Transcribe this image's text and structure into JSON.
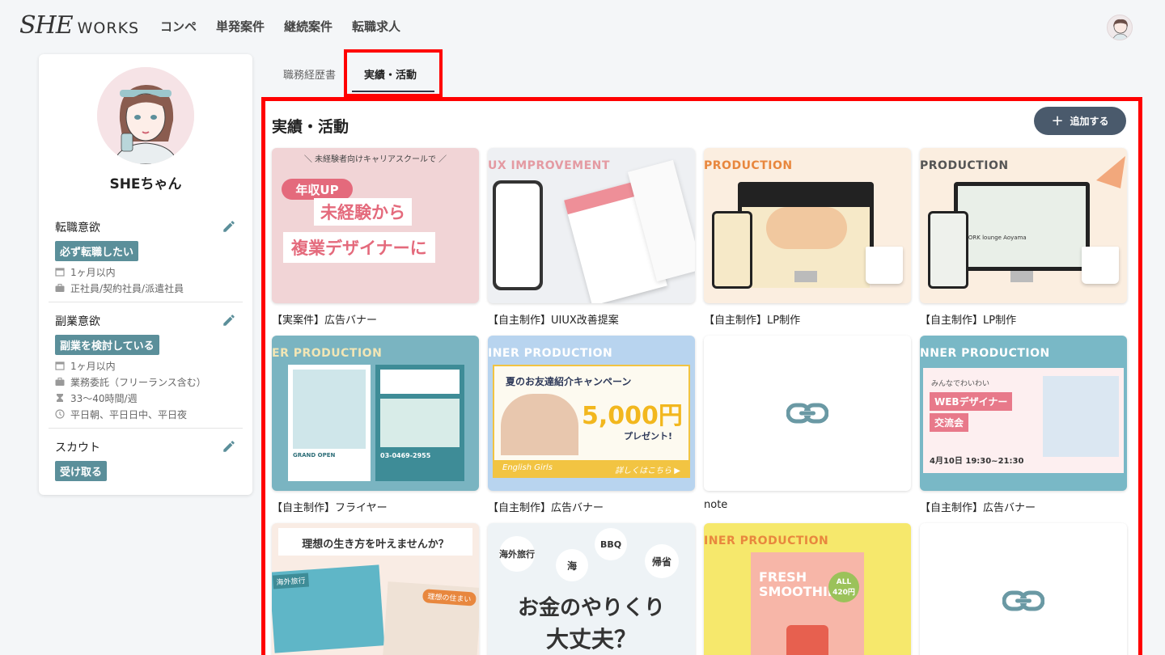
{
  "header": {
    "logo_she": "SHE",
    "logo_works": "WORKS",
    "nav": [
      "コンペ",
      "単発案件",
      "継続案件",
      "転職求人"
    ]
  },
  "profile": {
    "name": "SHEちゃん",
    "sections": [
      {
        "title": "転職意欲",
        "badge": "必ず転職したい",
        "meta": [
          "1ヶ月以内",
          "正社員/契約社員/派遣社員"
        ]
      },
      {
        "title": "副業意欲",
        "badge": "副業を検討している",
        "meta": [
          "1ヶ月以内",
          "業務委託（フリーランス含む）",
          "33〜40時間/週",
          "平日朝、平日日中、平日夜"
        ]
      },
      {
        "title": "スカウト",
        "badge": "受け取る"
      }
    ]
  },
  "tabs": [
    "職務経歴書",
    "実績・活動"
  ],
  "main": {
    "title": "実績・活動",
    "add_button": "追加する",
    "cards": [
      {
        "caption": "【実案件】広告バナー",
        "lines": [
          "＼ 未経験者向けキャリアスクールで ／",
          "年収UP",
          "未経験から",
          "複業デザイナーに"
        ]
      },
      {
        "caption": "【自主制作】UIUX改善提案",
        "header": "UX IMPROVEMENT"
      },
      {
        "caption": "【自主制作】LP制作",
        "header": "PRODUCTION"
      },
      {
        "caption": "【自主制作】LP制作",
        "header": "PRODUCTION",
        "sign": "WORK lounge Aoyama"
      },
      {
        "caption": "【自主制作】フライヤー",
        "header": "ER PRODUCTION",
        "lines": [
          "GRAND OPEN",
          "03-0469-2955"
        ]
      },
      {
        "caption": "【自主制作】広告バナー",
        "header": "INER PRODUCTION",
        "lines": [
          "夏のお友達紹介キャンペーン",
          "5,000円",
          "プレゼント!",
          "English Girls",
          "詳しくはこちら ▶"
        ]
      },
      {
        "caption": "note"
      },
      {
        "caption": "【自主制作】広告バナー",
        "header": "NNER PRODUCTION",
        "lines": [
          "みんなでわいわい",
          "WEBデザイナー",
          "交流会",
          "4月10日 19:30~21:30"
        ]
      },
      {
        "lines": [
          "理想の生き方を叶えませんか？",
          "海外旅行",
          "理想の住まい"
        ]
      },
      {
        "lines": [
          "海外旅行",
          "海",
          "BBQ",
          "帰省",
          "お金のやりくり",
          "大丈夫？"
        ]
      },
      {
        "header": "INER PRODUCTION",
        "lines": [
          "FRESH SMOOTHIE",
          "ALL 420円"
        ]
      },
      {}
    ]
  },
  "colors": {
    "accent_red": "#ff0000",
    "badge_teal": "#5b8f9a",
    "button_dark": "#4a5a6c"
  }
}
